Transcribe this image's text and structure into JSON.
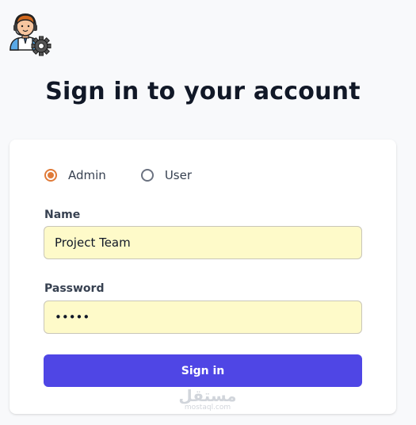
{
  "logo": {
    "icon": "support-agent-gear-icon"
  },
  "header": {
    "title": "Sign in to your account"
  },
  "form": {
    "roles": [
      {
        "label": "Admin",
        "checked": true
      },
      {
        "label": "User",
        "checked": false
      }
    ],
    "name": {
      "label": "Name",
      "value": "Project Team"
    },
    "password": {
      "label": "Password",
      "value": "•••••"
    },
    "submit_label": "Sign in"
  },
  "watermark": {
    "arabic": "مستقل",
    "latin": "mostaql.com"
  },
  "colors": {
    "accent": "#4f46e5",
    "radio_checked": "#e07b39",
    "input_background": "#fefac9"
  }
}
